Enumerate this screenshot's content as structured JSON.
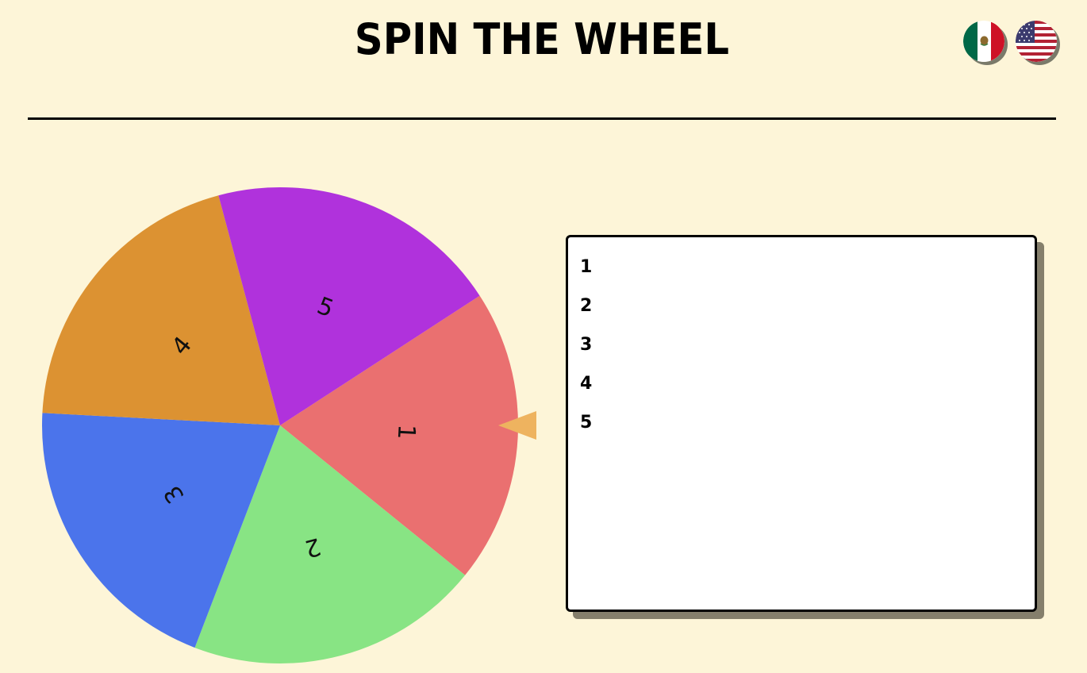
{
  "header": {
    "title": "SPIN THE WHEEL"
  },
  "language_flags": [
    {
      "name": "mexico-flag",
      "country": "Mexico"
    },
    {
      "name": "usa-flag",
      "country": "United States"
    }
  ],
  "wheel": {
    "segments": [
      {
        "label": "1",
        "color": "#ea7070"
      },
      {
        "label": "2",
        "color": "#88e484"
      },
      {
        "label": "3",
        "color": "#4b74eb"
      },
      {
        "label": "4",
        "color": "#dc9232"
      },
      {
        "label": "5",
        "color": "#b032dc"
      }
    ],
    "pointer_color": "#eeb35f"
  },
  "entries": {
    "items": [
      "1",
      "2",
      "3",
      "4",
      "5"
    ]
  }
}
